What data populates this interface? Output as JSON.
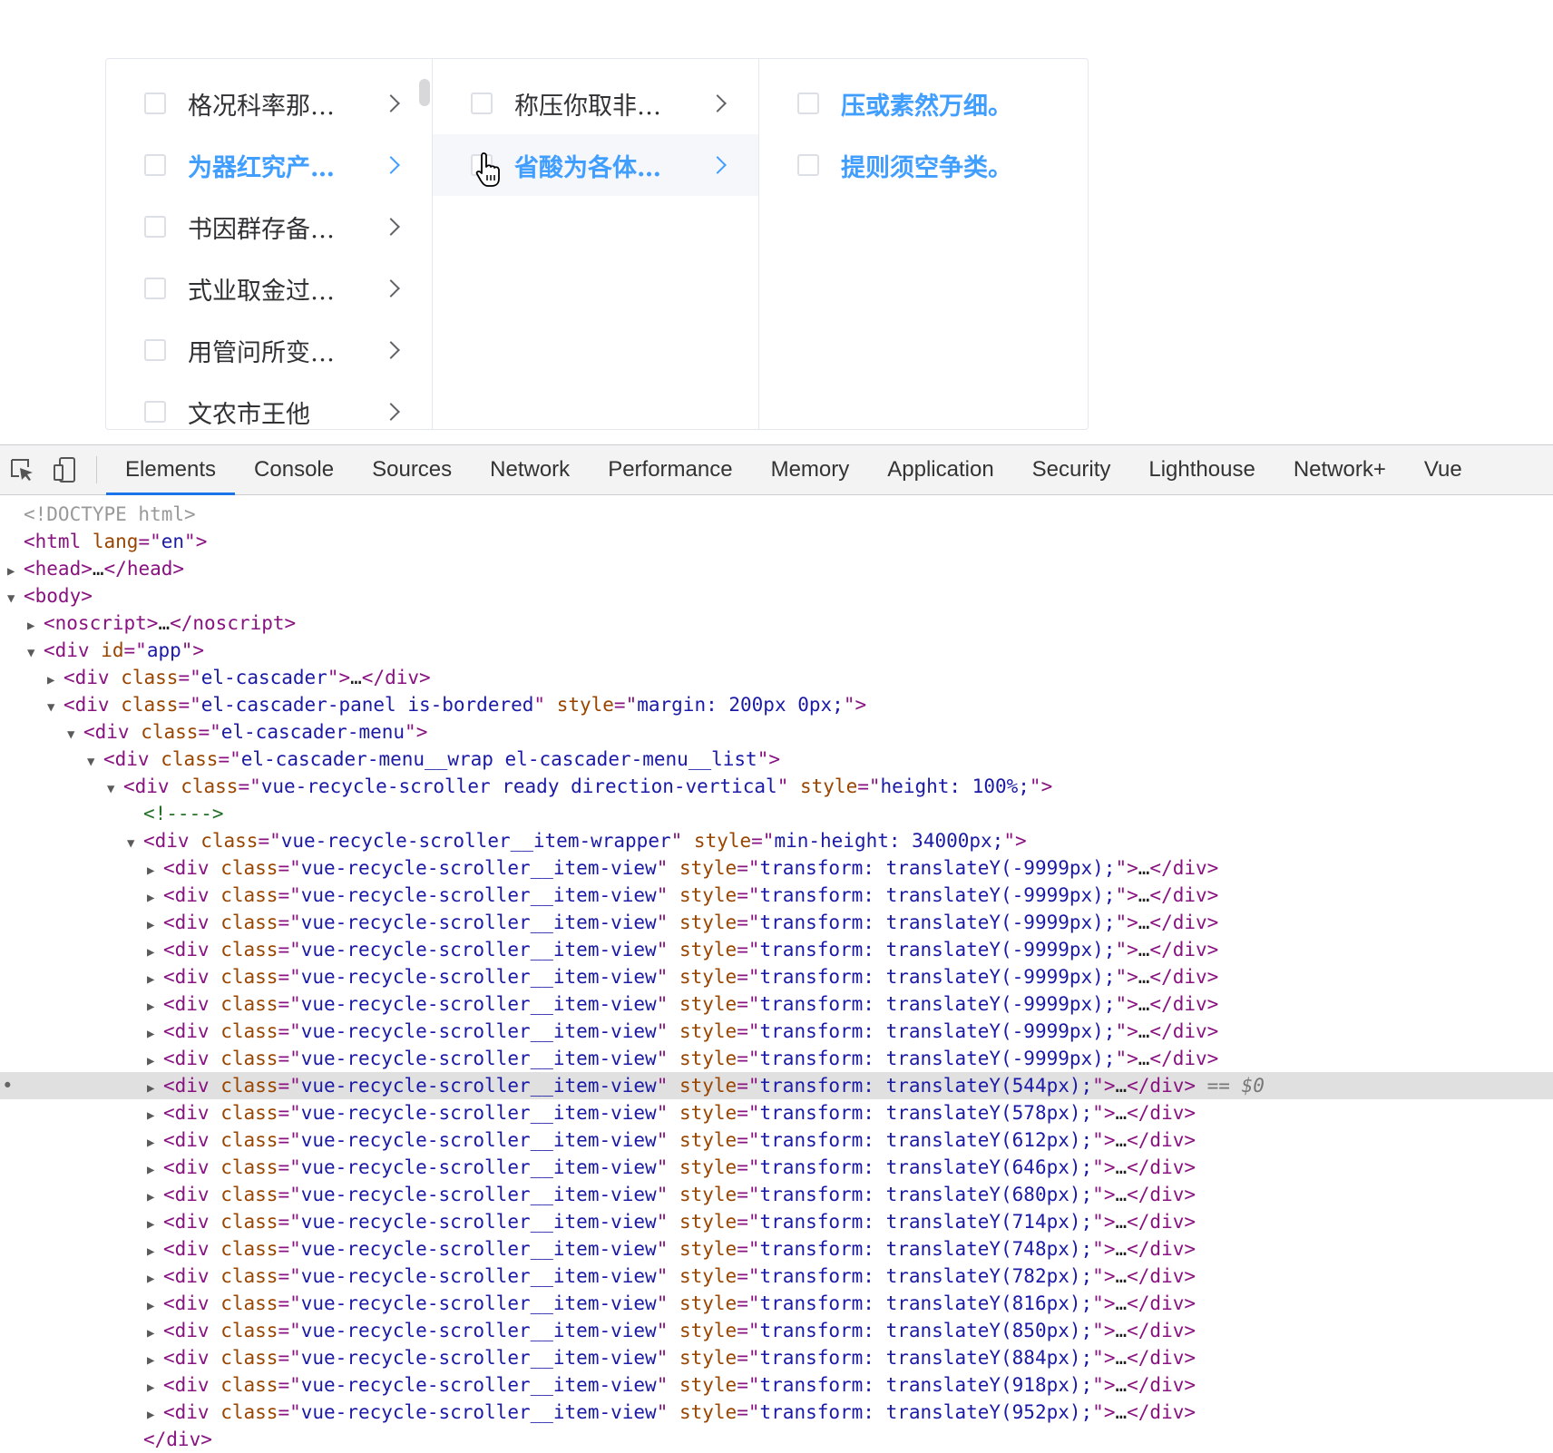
{
  "cascader": {
    "menu1": [
      {
        "label": "格况科率那…",
        "active": false
      },
      {
        "label": "为器红究产…",
        "active": true
      },
      {
        "label": "书因群存备…",
        "active": false
      },
      {
        "label": "式业取金过…",
        "active": false
      },
      {
        "label": "用管问所变…",
        "active": false
      },
      {
        "label": "文农市王他",
        "active": false
      }
    ],
    "menu2": [
      {
        "label": "称压你取非…",
        "active": false
      },
      {
        "label": "省酸为各体…",
        "active": true
      }
    ],
    "menu3": [
      {
        "label": "压或素然万细。",
        "active": true
      },
      {
        "label": "提则须空争类。",
        "active": true
      }
    ]
  },
  "devtools": {
    "tabs": [
      "Elements",
      "Console",
      "Sources",
      "Network",
      "Performance",
      "Memory",
      "Application",
      "Security",
      "Lighthouse",
      "Network+",
      "Vue"
    ],
    "selected_tab": "Elements",
    "dom": {
      "doctype": "<!DOCTYPE html>",
      "html_open": "<html lang=\"en\">",
      "head": "<head>…</head>",
      "body": "<body>",
      "noscript": "<noscript>…</noscript>",
      "app": "<div id=\"app\">",
      "el_cascader": "<div class=\"el-cascader\">…</div>",
      "panel": "<div class=\"el-cascader-panel is-bordered\" style=\"margin: 200px 0px;\">",
      "menu": "<div class=\"el-cascader-menu\">",
      "wrap": "<div class=\"el-cascader-menu__wrap el-cascader-menu__list\">",
      "scroller": "<div class=\"vue-recycle-scroller ready direction-vertical\" style=\"height: 100%;\">",
      "comment": "<!---->",
      "item_wrapper": "<div class=\"vue-recycle-scroller__item-wrapper\" style=\"min-height: 34000px;\">",
      "item_views": [
        "-9999px",
        "-9999px",
        "-9999px",
        "-9999px",
        "-9999px",
        "-9999px",
        "-9999px",
        "-9999px",
        "544px",
        "578px",
        "612px",
        "646px",
        "680px",
        "714px",
        "748px",
        "782px",
        "816px",
        "850px",
        "884px",
        "918px",
        "952px"
      ],
      "item_view_class": "vue-recycle-scroller__item-view",
      "selected_marker": " == $0",
      "closing": "</div>"
    }
  }
}
